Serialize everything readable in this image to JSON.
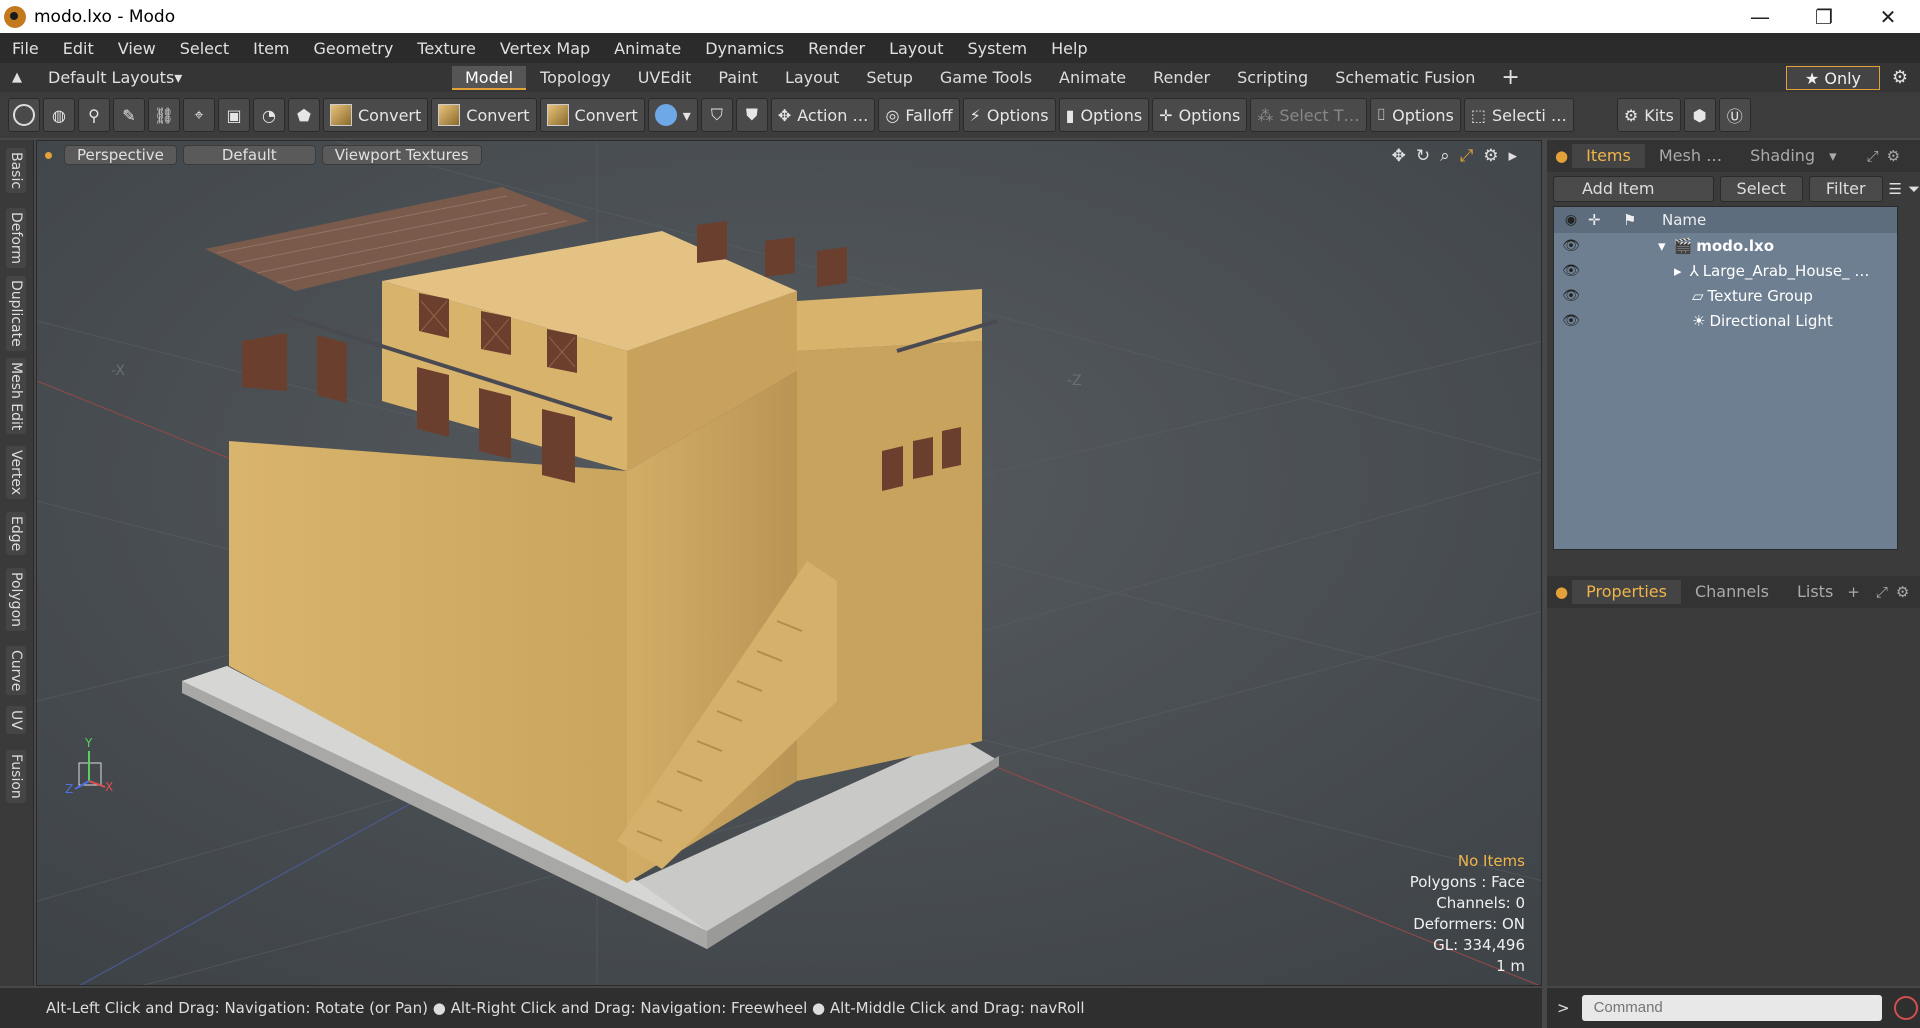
{
  "window": {
    "title": "modo.lxo - Modo",
    "minimize": "—",
    "maximize": "❐",
    "close": "✕"
  },
  "menu": [
    "File",
    "Edit",
    "View",
    "Select",
    "Item",
    "Geometry",
    "Texture",
    "Vertex Map",
    "Animate",
    "Dynamics",
    "Render",
    "Layout",
    "System",
    "Help"
  ],
  "layouts": {
    "label": "Default Layouts",
    "arrow": "▾"
  },
  "tabs": [
    "Model",
    "Topology",
    "UVEdit",
    "Paint",
    "Layout",
    "Setup",
    "Game Tools",
    "Animate",
    "Render",
    "Scripting",
    "Schematic Fusion"
  ],
  "active_tab": "Model",
  "only_label": "★  Only",
  "toolbar": {
    "convert1": "Convert",
    "convert2": "Convert",
    "convert3": "Convert",
    "action": "Action …",
    "falloff": "Falloff",
    "options1": "Options",
    "options2": "Options",
    "options3": "Options",
    "select_t": "Select T…",
    "options4": "Options",
    "selecti": "Selecti …",
    "kits": "Kits"
  },
  "side_tabs": [
    "Basic",
    "Deform",
    "Duplicate",
    "Mesh Edit",
    "Vertex",
    "Edge",
    "Polygon",
    "Curve",
    "UV",
    "Fusion"
  ],
  "viewport": {
    "view": "Perspective",
    "shading": "Default",
    "textures": "Viewport Textures",
    "info": {
      "items": "No Items",
      "polygons": "Polygons : Face",
      "channels": "Channels: 0",
      "deformers": "Deformers: ON",
      "gl": "GL: 334,496",
      "scale": "1 m"
    },
    "axis_x": "-X",
    "axis_z": "-Z"
  },
  "items_panel": {
    "tabs": [
      "Items",
      "Mesh …",
      "Shading"
    ],
    "add_item": "Add Item",
    "select": "Select",
    "filter": "Filter",
    "col_name": "Name",
    "rows": [
      {
        "name": "modo.lxo"
      },
      {
        "name": "Large_Arab_House_ …"
      },
      {
        "name": "Texture Group"
      },
      {
        "name": "Directional Light"
      }
    ]
  },
  "properties_panel": {
    "tabs": [
      "Properties",
      "Channels",
      "Lists"
    ]
  },
  "status": "Alt-Left Click and Drag: Navigation: Rotate (or Pan) ● Alt-Right Click and Drag: Navigation: Freewheel ● Alt-Middle Click and Drag: navRoll",
  "command_placeholder": "Command",
  "command_prompt": ">"
}
